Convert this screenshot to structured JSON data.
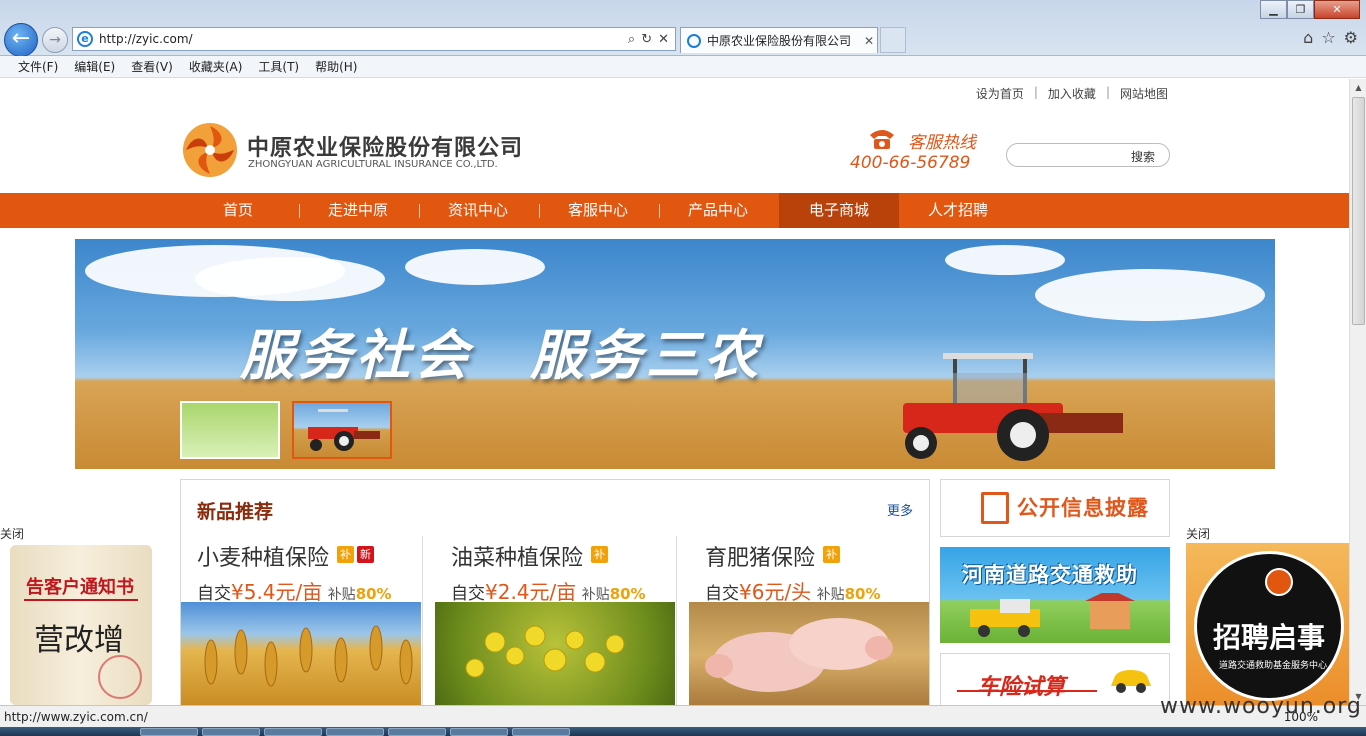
{
  "browser": {
    "url": "http://zyic.com/",
    "tab_title": "中原农业保险股份有限公司",
    "tab_close": "✕",
    "menus": [
      "文件(F)",
      "编辑(E)",
      "查看(V)",
      "收藏夹(A)",
      "工具(T)",
      "帮助(H)"
    ],
    "status_url": "http://www.zyic.com.cn/",
    "zoom": "100%"
  },
  "toplinks": {
    "set_home": "设为首页",
    "add_fav": "加入收藏",
    "sitemap": "网站地图",
    "sep": "|"
  },
  "logo": {
    "cn": "中原农业保险股份有限公司",
    "en": "ZHONGYUAN AGRICULTURAL INSURANCE CO.,LTD."
  },
  "hotline": {
    "label": "客服热线",
    "number": "400-66-56789"
  },
  "search": {
    "button": "搜索"
  },
  "nav": [
    "首页",
    "走进中原",
    "资讯中心",
    "客服中心",
    "产品中心",
    "电子商城",
    "人才招聘"
  ],
  "banner": {
    "slogan": "服务社会　服务三农"
  },
  "new_products": {
    "title": "新品推荐",
    "more": "更多",
    "items": [
      {
        "name": "小麦种植保险",
        "tags": [
          "补",
          "新"
        ],
        "prefix": "自交",
        "amount": "¥5.4元/亩",
        "sub": "补贴",
        "pct": "80%"
      },
      {
        "name": "油菜种植保险",
        "tags": [
          "补"
        ],
        "prefix": "自交",
        "amount": "¥2.4元/亩",
        "sub": "补贴",
        "pct": "80%"
      },
      {
        "name": "育肥猪保险",
        "tags": [
          "补"
        ],
        "prefix": "自交",
        "amount": "¥6元/头",
        "sub": "补贴",
        "pct": "80%"
      }
    ]
  },
  "side": {
    "disclosure": "公开信息披露",
    "rescue": "河南道路交通救助",
    "calc": "车险试算"
  },
  "float_left": {
    "close": "关闭",
    "heading": "告客户通知书",
    "body": "营改增"
  },
  "float_right": {
    "close": "关闭",
    "heading": "招聘启事",
    "sub": "道路交通救助基金服务中心"
  },
  "watermark": "www.wooyun.org",
  "colors": {
    "brand_orange": "#e1570f",
    "nav_active": "#b9410a",
    "title_red": "#8b2b0c"
  }
}
